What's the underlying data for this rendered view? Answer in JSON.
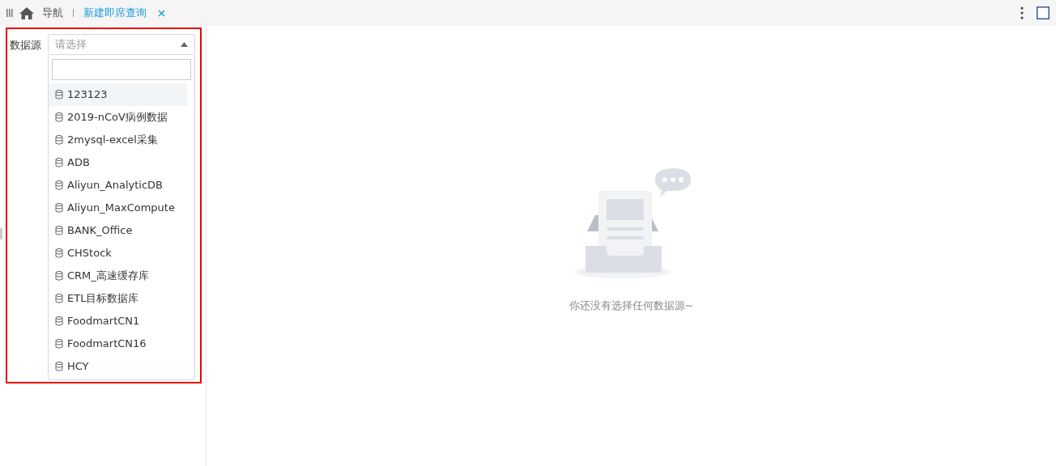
{
  "tabs": [
    {
      "label": "导航",
      "kind": "home",
      "selected": false
    },
    {
      "label": "新建即席查询",
      "kind": "query",
      "selected": true
    }
  ],
  "datasource": {
    "label": "数据源",
    "placeholder": "请选择",
    "items": [
      {
        "label": "123123",
        "selected": true
      },
      {
        "label": "2019-nCoV病例数据",
        "selected": false
      },
      {
        "label": "2mysql-excel采集",
        "selected": false
      },
      {
        "label": "ADB",
        "selected": false
      },
      {
        "label": "Aliyun_AnalyticDB",
        "selected": false
      },
      {
        "label": "Aliyun_MaxCompute",
        "selected": false
      },
      {
        "label": "BANK_Office",
        "selected": false
      },
      {
        "label": "CHStock",
        "selected": false
      },
      {
        "label": "CRM_高速缓存库",
        "selected": false
      },
      {
        "label": "ETL目标数据库",
        "selected": false
      },
      {
        "label": "FoodmartCN1",
        "selected": false
      },
      {
        "label": "FoodmartCN16",
        "selected": false
      },
      {
        "label": "HCY",
        "selected": false
      }
    ]
  },
  "empty_message": "你还没有选择任何数据源~"
}
